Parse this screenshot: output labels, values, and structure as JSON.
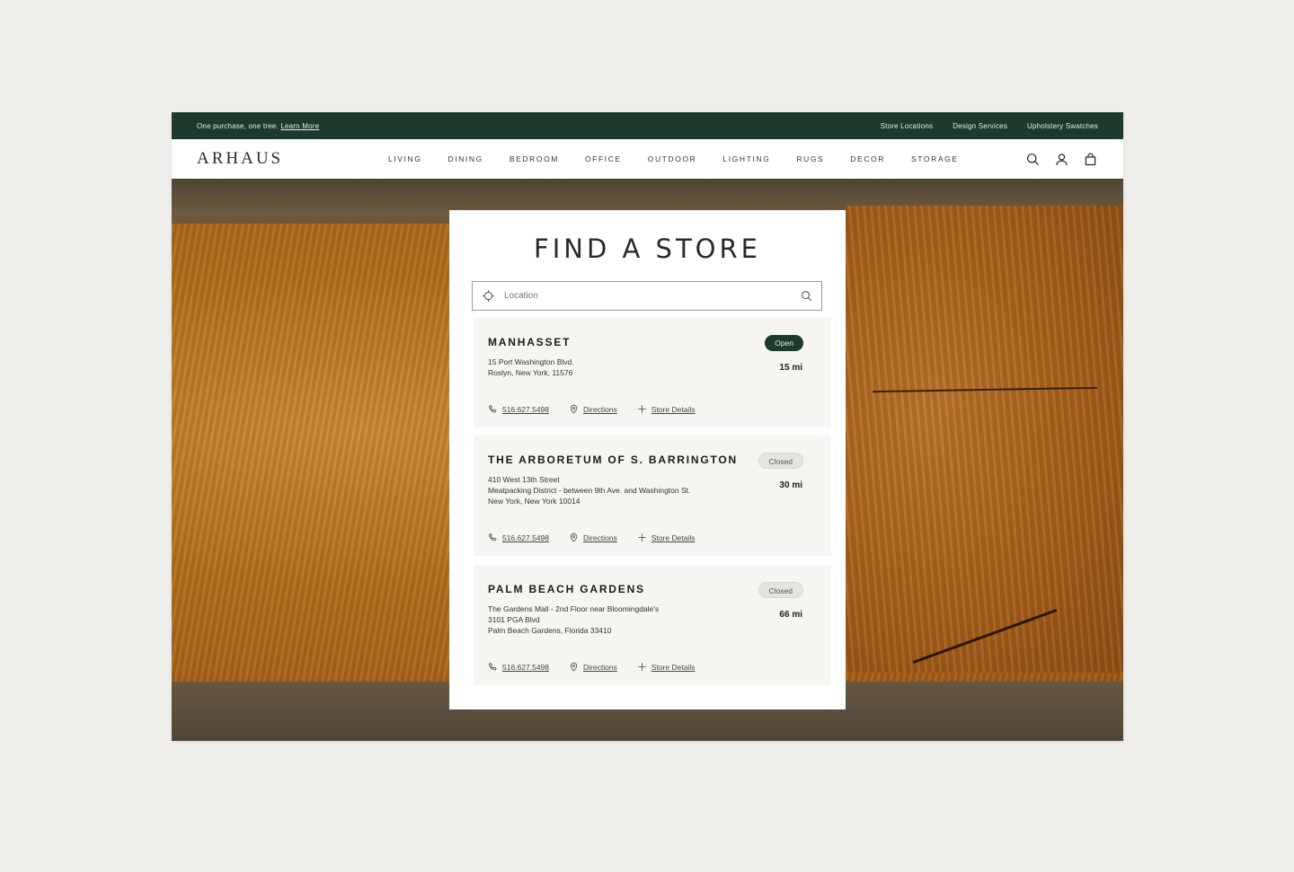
{
  "promo": {
    "text": "One purchase, one tree.",
    "link": "Learn More"
  },
  "utility_links": [
    "Store Locations",
    "Design Services",
    "Upholstery Swatches"
  ],
  "brand": {
    "logo": "ARHAUS"
  },
  "nav": {
    "items": [
      "LIVING",
      "DINING",
      "BEDROOM",
      "OFFICE",
      "OUTDOOR",
      "LIGHTING",
      "RUGS",
      "DECOR",
      "STORAGE"
    ]
  },
  "finder": {
    "title": "FIND A STORE",
    "search": {
      "placeholder": "Location"
    }
  },
  "stores": [
    {
      "name": "MANHASSET",
      "address": [
        "15 Port Washington Blvd.",
        "Roslyn, New York, 11576"
      ],
      "status": "Open",
      "distance": "15 mi",
      "phone": "516.627.5498",
      "directions": "Directions",
      "details": "Store Details"
    },
    {
      "name": "THE ARBORETUM OF S. BARRINGTON",
      "address": [
        "410 West 13th Street",
        "Meatpacking District - between 9th Ave. and Washington St.",
        "New York, New York 10014"
      ],
      "status": "Closed",
      "distance": "30 mi",
      "phone": "516.627.5498",
      "directions": "Directions",
      "details": "Store Details"
    },
    {
      "name": "PALM BEACH GARDENS",
      "address": [
        "The Gardens Mall - 2nd Floor near Bloomingdale's",
        "3101 PGA Blvd",
        "Palm Beach Gardens, Florida 33410"
      ],
      "status": "Closed",
      "distance": "66 mi",
      "phone": "516.627.5498",
      "directions": "Directions",
      "details": "Store Details"
    }
  ],
  "colors": {
    "brand_green": "#1e3a2c",
    "card_bg": "#f6f5f1",
    "page_bg": "#efede9"
  }
}
